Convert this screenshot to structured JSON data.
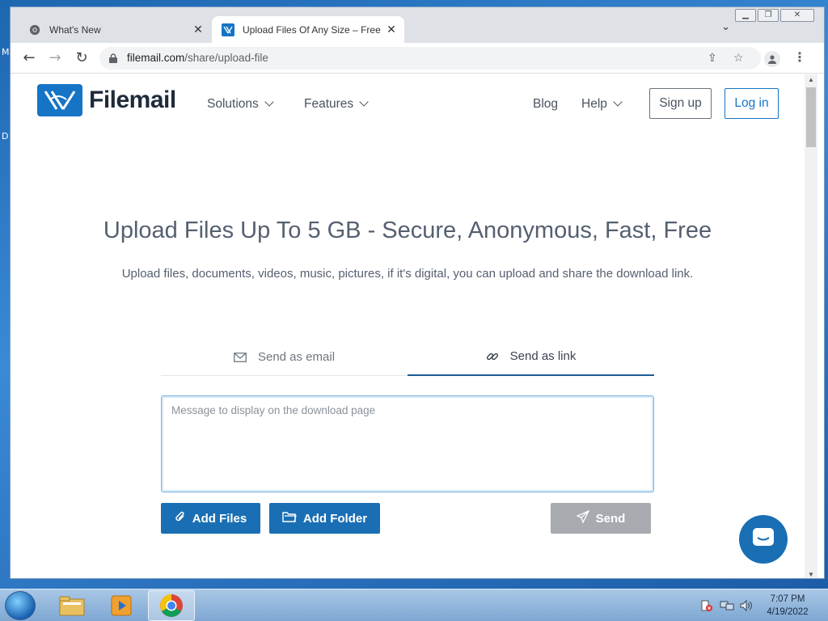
{
  "desktop": {
    "left_letters": [
      "M",
      "D"
    ]
  },
  "browser": {
    "tabs": [
      {
        "title": "What's New",
        "icon": "chrome-icon"
      },
      {
        "title": "Upload Files Of Any Size – Free U",
        "icon": "filemail-favicon"
      }
    ],
    "address": {
      "host": "filemail.com",
      "path": "/share/upload-file"
    }
  },
  "site": {
    "brand": "Filemail",
    "nav": {
      "solutions": "Solutions",
      "features": "Features",
      "blog": "Blog",
      "help": "Help"
    },
    "signup": "Sign up",
    "login": "Log in"
  },
  "hero": {
    "title": "Upload Files Up To 5 GB - Secure, Anonymous, Fast, Free",
    "subtitle": "Upload files, documents, videos, music, pictures, if it's digital, you can upload and share the download link."
  },
  "send_tabs": {
    "email": "Send as email",
    "link": "Send as link",
    "active": "link"
  },
  "message": {
    "placeholder": "Message to display on the download page",
    "value": ""
  },
  "actions": {
    "add_files": "Add Files",
    "add_folder": "Add Folder",
    "send": "Send"
  },
  "taskbar": {
    "time": "7:07 PM",
    "date": "4/19/2022"
  },
  "colors": {
    "brand": "#1574c6",
    "text": "#556070",
    "send_disabled": "#a7abaf"
  }
}
